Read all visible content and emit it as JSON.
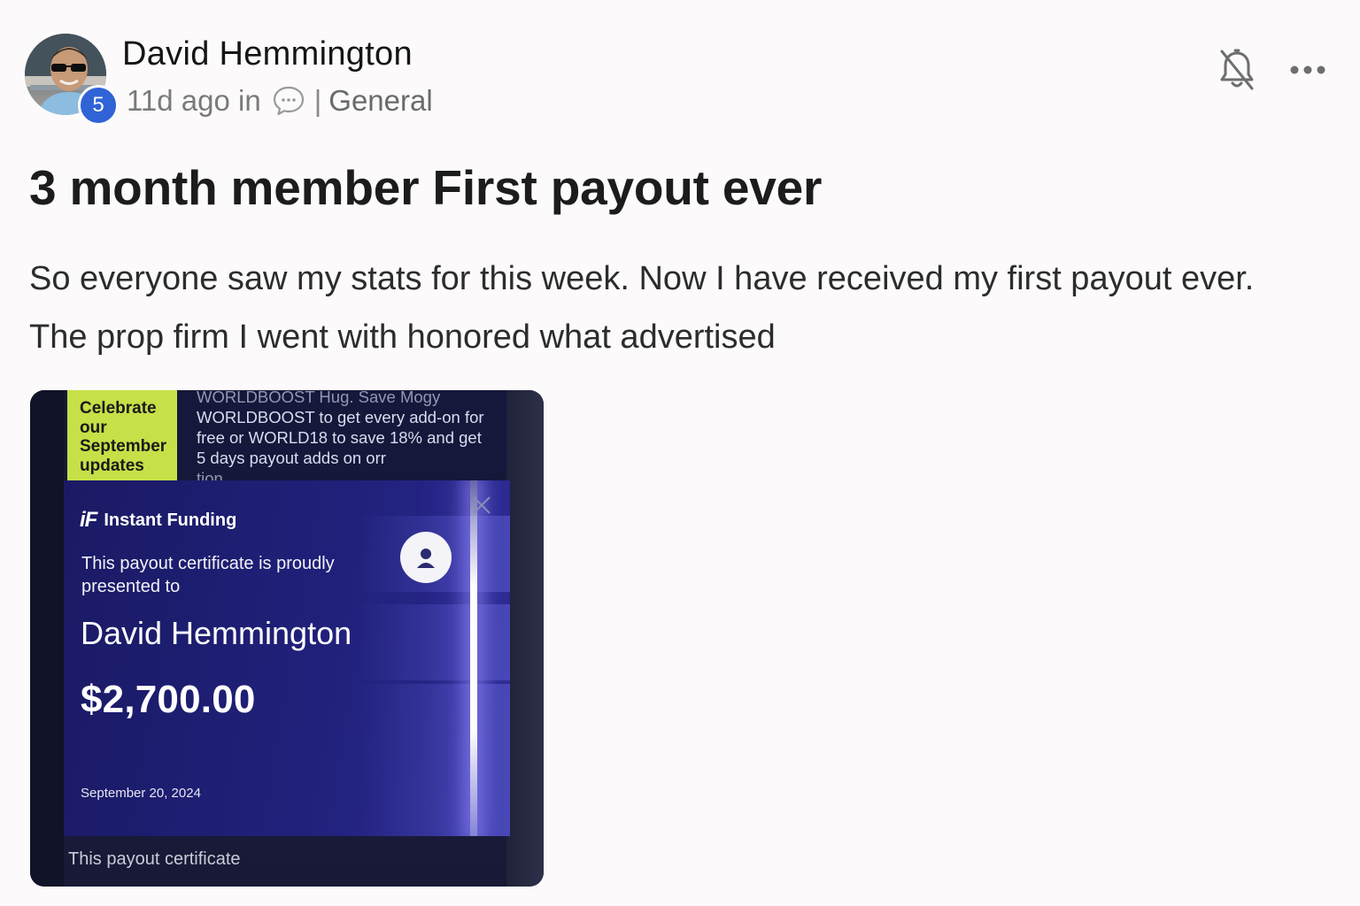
{
  "author": {
    "name": "David Hemmington",
    "level": "5",
    "time_ago": "11d ago in",
    "separator": "|",
    "category": "General"
  },
  "actions": {
    "notifications_icon": "bell-off-icon",
    "more_icon": "more-horizontal-icon"
  },
  "post": {
    "title": "3 month member First payout ever",
    "body_lines": [
      "So everyone saw my stats for this week. Now I have received my first payout ever.",
      "The prop firm I went with honored what advertised"
    ]
  },
  "attachment": {
    "promo_badge": "Celebrate our September updates",
    "promo_text_top": "WORLDBOOST Hug. Save Mogy",
    "promo_text": "WORLDBOOST to get every add-on for free or WORLD18 to save 18% and get 5 days payout adds on orr",
    "promo_text_bottom": "tion",
    "certificate": {
      "logo_mark": "iF",
      "brand": "Instant Funding",
      "presented_text": "This payout certificate is proudly presented to",
      "recipient": "David Hemmington",
      "amount": "$2,700.00",
      "date": "September 20, 2024"
    },
    "footer": "This payout certificate"
  },
  "colors": {
    "background": "#fcfafa",
    "level_badge": "#2f63d6",
    "promo_badge": "#c6e048",
    "certificate_bg": "#1f1f78"
  }
}
